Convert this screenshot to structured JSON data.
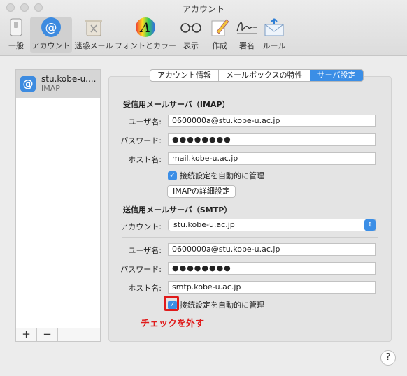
{
  "window": {
    "title": "アカウント"
  },
  "toolbar": {
    "items": [
      {
        "label": "一般",
        "icon": "switch-icon"
      },
      {
        "label": "アカウント",
        "icon": "at-sign-icon"
      },
      {
        "label": "迷惑メール",
        "icon": "trash-icon"
      },
      {
        "label": "フォントとカラー",
        "icon": "font-color-icon"
      },
      {
        "label": "表示",
        "icon": "glasses-icon"
      },
      {
        "label": "作成",
        "icon": "pencil-icon"
      },
      {
        "label": "署名",
        "icon": "signature-icon"
      },
      {
        "label": "ルール",
        "icon": "rules-envelope-icon"
      }
    ]
  },
  "accounts": [
    {
      "name": "stu.kobe-u....",
      "type": "IMAP"
    }
  ],
  "list_footer": {
    "add": "+",
    "remove": "−"
  },
  "tabs": [
    {
      "label": "アカウント情報",
      "selected": false
    },
    {
      "label": "メールボックスの特性",
      "selected": false
    },
    {
      "label": "サーバ設定",
      "selected": true
    }
  ],
  "incoming": {
    "section_title": "受信用メールサーバ（IMAP）",
    "username_label": "ユーザ名:",
    "username": "0600000a@stu.kobe-u.ac.jp",
    "password_label": "パスワード:",
    "password": "●●●●●●●●",
    "host_label": "ホスト名:",
    "host": "mail.kobe-u.ac.jp",
    "auto_manage_label": "接続設定を自動的に管理",
    "auto_manage_checked": true,
    "advanced_button": "IMAPの詳細設定"
  },
  "outgoing": {
    "section_title": "送信用メールサーバ（SMTP）",
    "account_label": "アカウント:",
    "account": "stu.kobe-u.ac.jp",
    "username_label": "ユーザ名:",
    "username": "0600000a@stu.kobe-u.ac.jp",
    "password_label": "パスワード:",
    "password": "●●●●●●●●",
    "host_label": "ホスト名:",
    "host": "smtp.kobe-u.ac.jp",
    "auto_manage_label": "接続設定を自動的に管理",
    "auto_manage_checked": true
  },
  "annotation": {
    "text": "チェックを外す",
    "color": "#e01b1b"
  },
  "help": {
    "label": "?"
  },
  "colors": {
    "accent": "#3b8ee6"
  }
}
